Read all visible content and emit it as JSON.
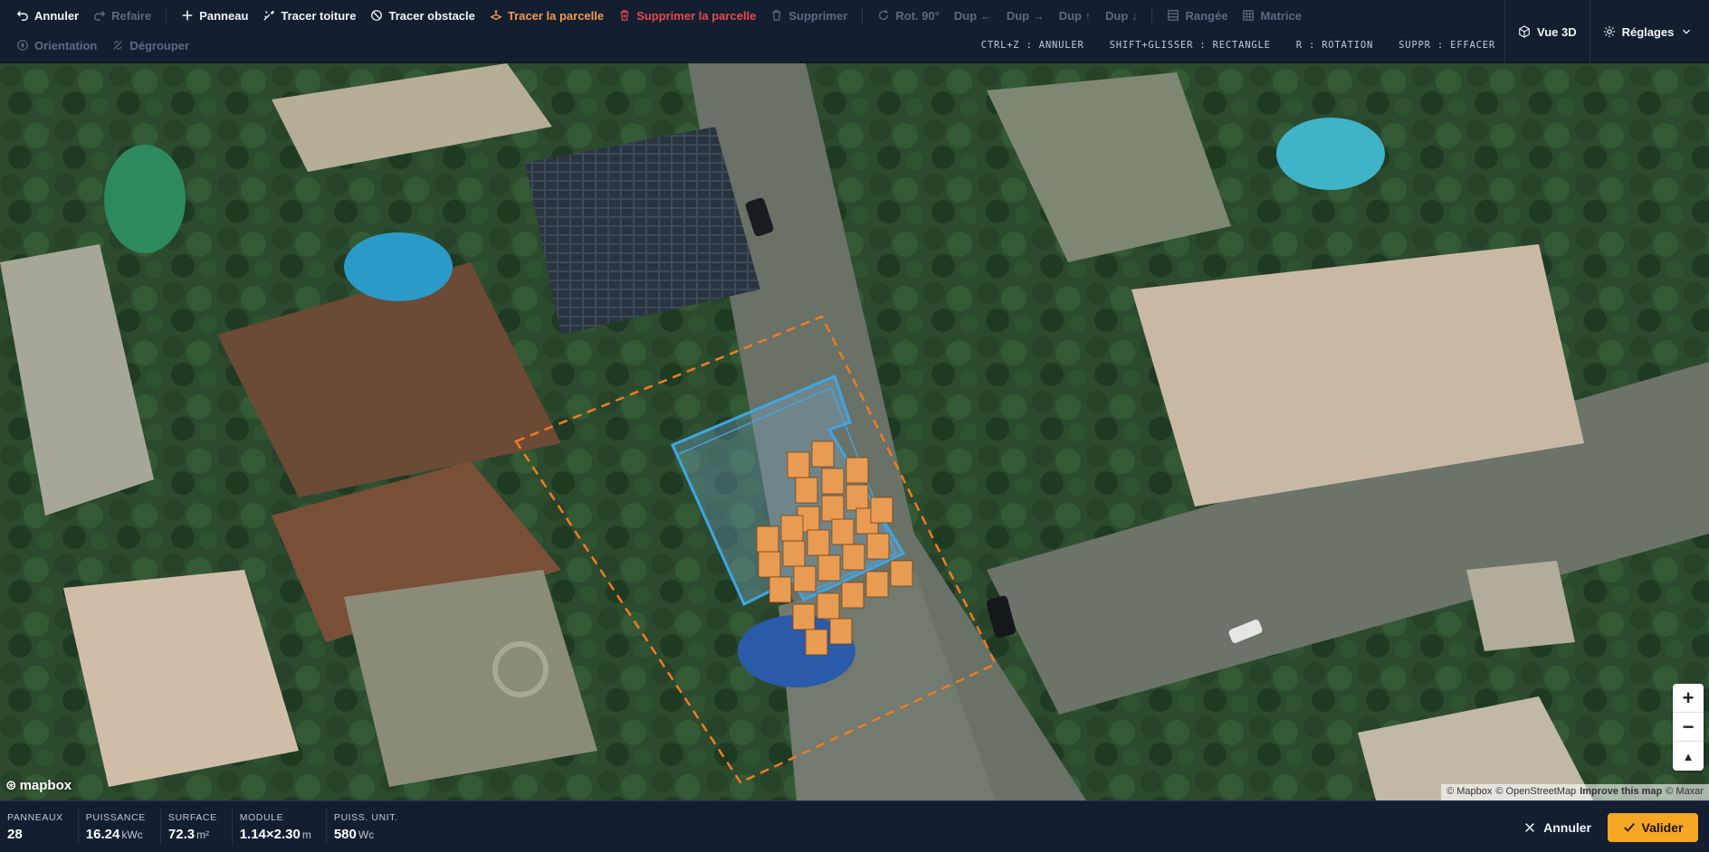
{
  "toolbar": {
    "undo": "Annuler",
    "redo": "Refaire",
    "panel": "Panneau",
    "trace_roof": "Tracer toiture",
    "trace_obstacle": "Tracer obstacle",
    "trace_parcel": "Tracer la parcelle",
    "delete_parcel": "Supprimer la parcelle",
    "delete": "Supprimer",
    "rotate": "Rot. 90°",
    "dup_left": "Dup ←",
    "dup_right": "Dup →",
    "dup_up": "Dup ↑",
    "dup_down": "Dup ↓",
    "row": "Rangée",
    "matrix": "Matrice",
    "orientation": "Orientation",
    "ungroup": "Dégrouper",
    "view_3d": "Vue 3D",
    "settings": "Réglages"
  },
  "shortcuts": [
    "CTRL+Z : ANNULER",
    "SHIFT+GLISSER : RECTANGLE",
    "R : ROTATION",
    "SUPPR : EFFACER"
  ],
  "map": {
    "logo": "mapbox",
    "attribution": {
      "mapbox": "© Mapbox",
      "osm": "© OpenStreetMap",
      "improve": "Improve this map",
      "maxar": "© Maxar"
    },
    "zoom_in": "+",
    "zoom_out": "−",
    "compass": "▲"
  },
  "status": {
    "panels_label": "PANNEAUX",
    "panels_value": "28",
    "power_label": "PUISSANCE",
    "power_value": "16.24",
    "power_unit": "kWc",
    "surface_label": "SURFACE",
    "surface_value": "72.3",
    "surface_unit": "m²",
    "module_label": "MODULE",
    "module_value": "1.14×2.30",
    "module_unit": "m",
    "unit_power_label": "PUISS. UNIT.",
    "unit_power_value": "580",
    "unit_power_unit": "Wc",
    "cancel": "Annuler",
    "validate": "Valider"
  },
  "colors": {
    "accent": "#f5a623",
    "parcel_outline": "#f07b22",
    "roof_outline": "#3ea6e6",
    "danger": "#e8484e"
  }
}
